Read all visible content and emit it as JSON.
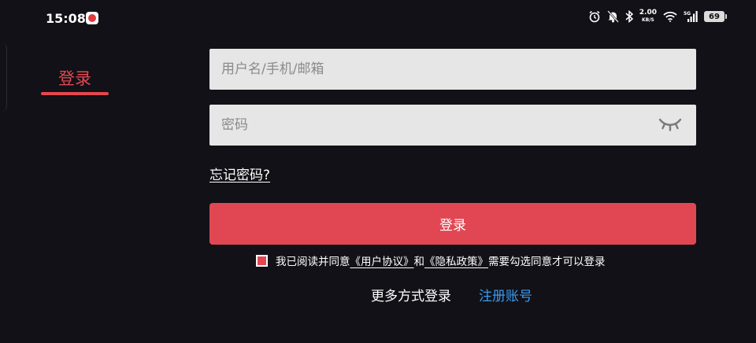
{
  "status_bar": {
    "time": "15:08",
    "net_speed_value": "2.00",
    "net_speed_unit": "KB/S",
    "battery": "69",
    "icons": [
      "app-notification-icon",
      "alarm-icon",
      "mute-icon",
      "bluetooth-icon",
      "wifi-icon",
      "5g-signal-icon",
      "battery-icon"
    ]
  },
  "tabs": {
    "login_label": "登录"
  },
  "form": {
    "username_placeholder": "用户名/手机/邮箱",
    "password_placeholder": "密码",
    "forgot_password": "忘记密码?",
    "login_button": "登录"
  },
  "agreement": {
    "prefix": "我已阅读并同意",
    "user_agreement": "《用户协议》",
    "and": "和",
    "privacy_policy": "《隐私政策》",
    "suffix": "需要勾选同意才可以登录",
    "checked": true
  },
  "footer": {
    "more_methods": "更多方式登录",
    "register": "注册账号"
  },
  "colors": {
    "background": "#111117",
    "accent": "#e14752",
    "link_blue": "#3b9bf0",
    "input_bg": "#e6e6e6"
  }
}
